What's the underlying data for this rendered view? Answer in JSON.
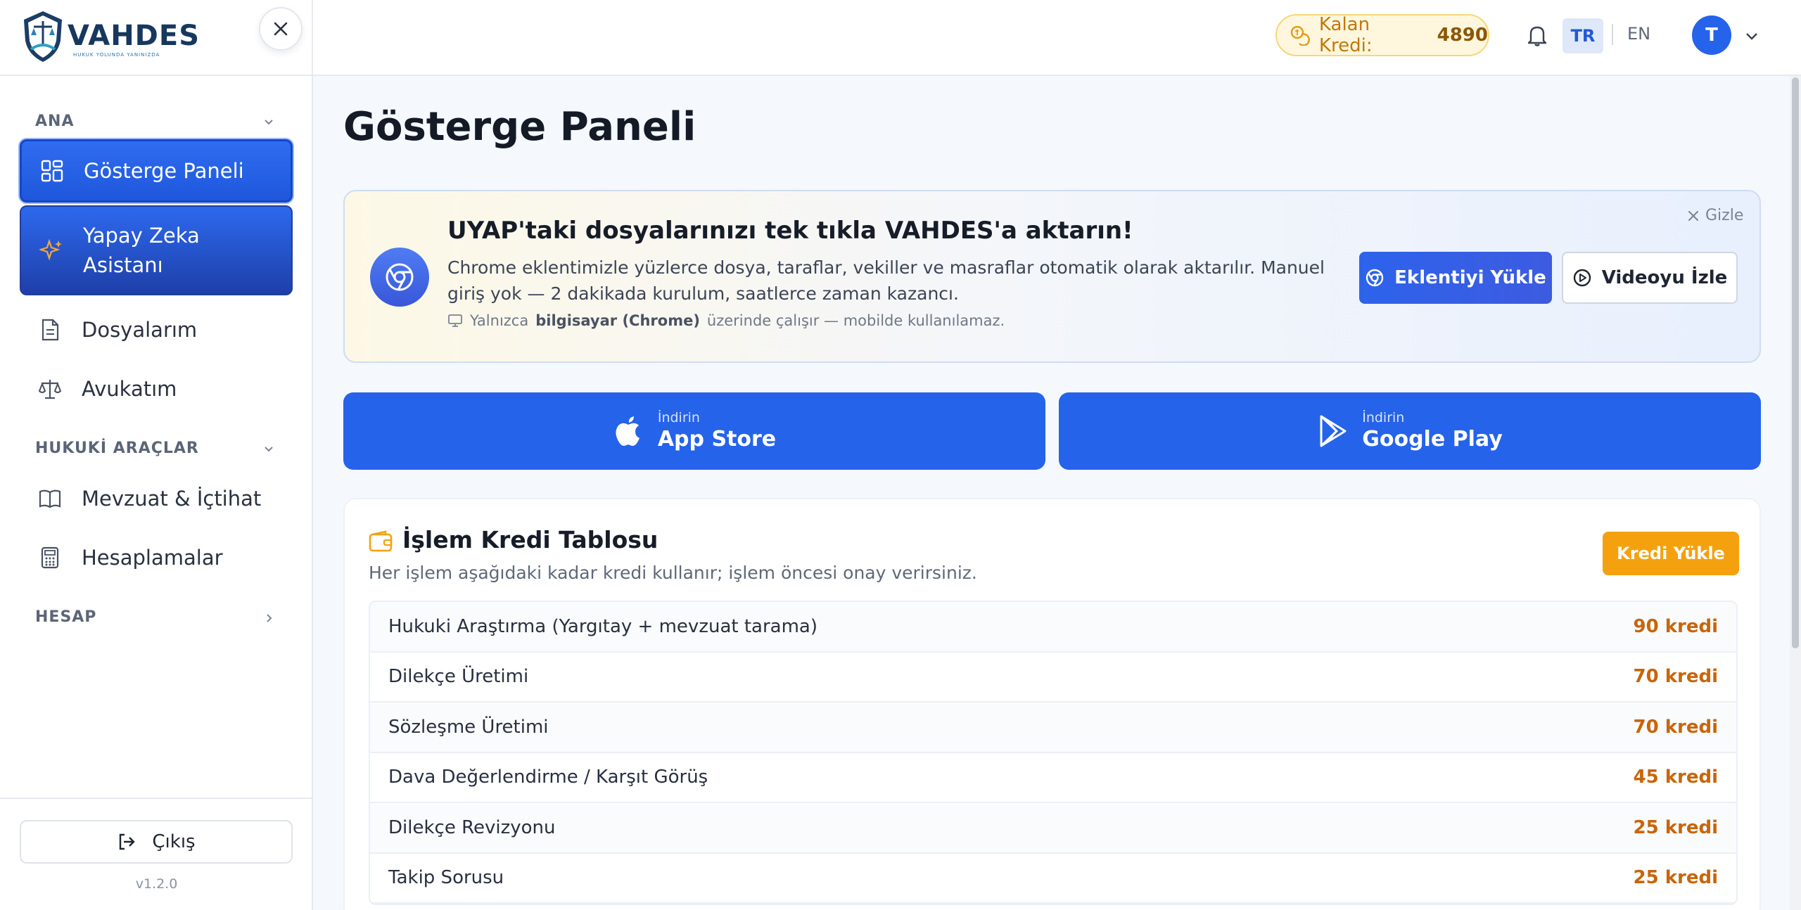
{
  "brand": {
    "name": "VAHDES",
    "tagline": "HUKUK YOLUNDA YANINIZDA"
  },
  "sidebar": {
    "sections": [
      {
        "label": "ANA"
      },
      {
        "label": "HUKUKİ ARAÇLAR"
      },
      {
        "label": "HESAP"
      }
    ],
    "items": [
      {
        "label": "Gösterge Paneli",
        "icon": "dashboard-icon"
      },
      {
        "label": "Yapay Zeka Asistanı",
        "icon": "sparkle-icon"
      },
      {
        "label": "Dosyalarım",
        "icon": "document-icon"
      },
      {
        "label": "Avukatım",
        "icon": "scales-icon"
      },
      {
        "label": "Mevzuat & İçtihat",
        "icon": "book-icon"
      },
      {
        "label": "Hesaplamalar",
        "icon": "calculator-icon"
      }
    ],
    "logout_label": "Çıkış",
    "version": "v1.2.0"
  },
  "topbar": {
    "credit_label": "Kalan Kredi:",
    "credit_value": "4890",
    "lang_tr": "TR",
    "lang_en": "EN",
    "avatar_initial": "T"
  },
  "main": {
    "title": "Gösterge Paneli",
    "banner": {
      "title": "UYAP'taki dosyalarınızı tek tıkla VAHDES'a aktarın!",
      "description": "Chrome eklentimizle yüzlerce dosya, taraflar, vekiller ve masraflar otomatik olarak aktarılır. Manuel giriş yok — 2 dakikada kurulum, saatlerce zaman kazancı.",
      "note_prefix": "Yalnızca",
      "note_bold": "bilgisayar (Chrome)",
      "note_suffix": "üzerinde çalışır — mobilde kullanılamaz.",
      "hide_label": "Gizle",
      "install_label": "Eklentiyi Yükle",
      "video_label": "Videoyu İzle"
    },
    "stores": [
      {
        "small": "İndirin",
        "big": "App Store"
      },
      {
        "small": "İndirin",
        "big": "Google Play"
      }
    ],
    "credit_table": {
      "title": "İşlem Kredi Tablosu",
      "subtitle": "Her işlem aşağıdaki kadar kredi kullanır; işlem öncesi onay verirsiniz.",
      "load_label": "Kredi Yükle",
      "rows": [
        {
          "name": "Hukuki Araştırma (Yargıtay + mevzuat tarama)",
          "cost": "90 kredi"
        },
        {
          "name": "Dilekçe Üretimi",
          "cost": "70 kredi"
        },
        {
          "name": "Sözleşme Üretimi",
          "cost": "70 kredi"
        },
        {
          "name": "Dava Değerlendirme / Karşıt Görüş",
          "cost": "45 kredi"
        },
        {
          "name": "Dilekçe Revizyonu",
          "cost": "25 kredi"
        },
        {
          "name": "Takip Sorusu",
          "cost": "25 kredi"
        }
      ]
    }
  },
  "colors": {
    "accent": "#2563eb",
    "credit": "#f5a10f",
    "cost": "#c8650a"
  }
}
